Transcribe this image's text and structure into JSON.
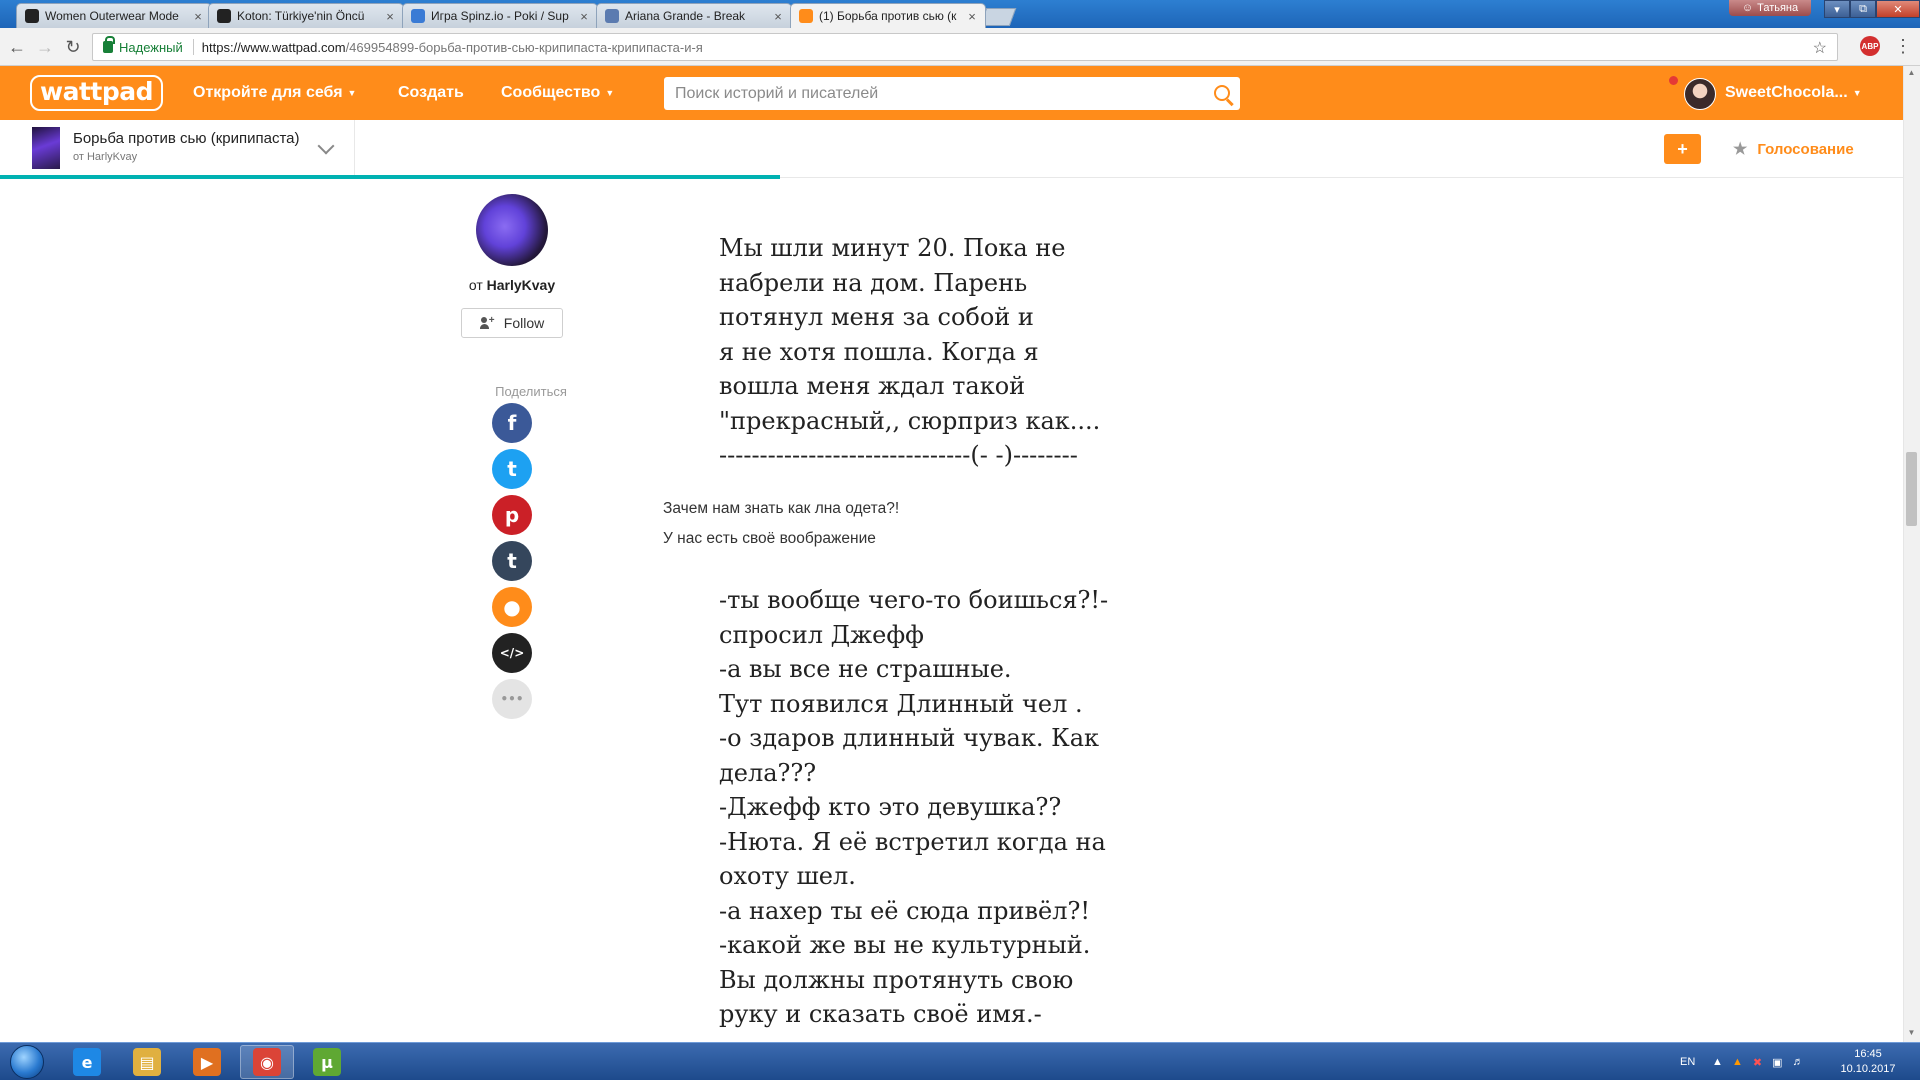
{
  "browser": {
    "tabs": [
      {
        "label": "Women Outerwear Mode",
        "icon": "koton-icon",
        "color": "#222222"
      },
      {
        "label": "Koton: Türkiye'nin Öncü",
        "icon": "koton-icon",
        "color": "#222222"
      },
      {
        "label": "Игра Spinz.io - Poki / Sup",
        "icon": "poki-icon",
        "color": "#3a7bd5"
      },
      {
        "label": "Ariana Grande - Break",
        "icon": "video-icon",
        "color": "#5b7bb0"
      },
      {
        "label": "(1) Борьба против сью (к",
        "icon": "wattpad-tab-icon",
        "color": "#ff8c1a"
      }
    ],
    "profile_name": "Татьяна",
    "secure_label": "Надежный",
    "url_host": "https://www.wattpad.com",
    "url_path": "/469954899-борьба-против-сью-крипипаста-крипипаста-и-я",
    "extension_badge": "ABP"
  },
  "header": {
    "logo": "wattpad",
    "nav_discover": "Откройте для себя",
    "nav_create": "Создать",
    "nav_community": "Сообщество",
    "search_placeholder": "Поиск историй и писателей",
    "username": "SweetChocola...",
    "accent": "#ff8c1a"
  },
  "storybar": {
    "title": "Борьба против сью (крипипаста)",
    "author_line": "от HarlyKvay",
    "add_button": "+",
    "vote_label": "Голосование",
    "progress_fraction": 0.41
  },
  "author": {
    "prefix": "от",
    "name": "HarlyKvay",
    "follow_label": "Follow"
  },
  "share": {
    "label": "Поделиться",
    "items": [
      {
        "name": "facebook-icon",
        "glyph": "f",
        "color": "#3b5998"
      },
      {
        "name": "twitter-icon",
        "glyph": "t",
        "color": "#1da1f2"
      },
      {
        "name": "pinterest-icon",
        "glyph": "p",
        "color": "#cb2027"
      },
      {
        "name": "tumblr-icon",
        "glyph": "t",
        "color": "#35465c"
      },
      {
        "name": "user-icon",
        "glyph": "●",
        "color": "#ff8c1a"
      },
      {
        "name": "embed-icon",
        "glyph": "</>",
        "color": "#222222"
      },
      {
        "name": "more-icon",
        "glyph": "•••",
        "color": "#e4e4e4"
      }
    ]
  },
  "story": {
    "block1": [
      "Мы шли минут 20. Пока не",
      "набрели на дом. Парень",
      "потянул меня за собой и",
      "я не хотя пошла. Когда я",
      "вошла меня ждал такой",
      "\"прекрасный,, сюрприз как....",
      "-------------------------------(-  -)--------"
    ],
    "note1": "Зачем нам знать как лна одета?!",
    "note2": "У нас есть своё вообрaжение",
    "block2": [
      "-ты вообще чего-то боишься?!-",
      "спросил Джефф",
      "-а вы все не страшные.",
      "Тут появился Длинный чел .",
      "-о здаров длинный чувак. Как",
      "дела???",
      "-Джефф кто это девушка??",
      "-Нюта. Я её встретил когда на",
      "охоту шел.",
      "-а нахер ты её сюда привёл?!",
      "-какой же вы не культурный.",
      "Вы должны протянуть свою",
      "руку и сказать своё имя.-"
    ]
  },
  "taskbar": {
    "apps": [
      {
        "name": "ie-icon",
        "glyph": "e",
        "color": "#1e88e5"
      },
      {
        "name": "explorer-icon",
        "glyph": "▤",
        "color": "#e0b040"
      },
      {
        "name": "media-player-icon",
        "glyph": "▶",
        "color": "#e07020"
      },
      {
        "name": "chrome-icon",
        "glyph": "◉",
        "color": "#db4437"
      },
      {
        "name": "utorrent-icon",
        "glyph": "µ",
        "color": "#5fa833"
      }
    ],
    "language": "EN",
    "time": "16:45",
    "date": "10.10.2017"
  }
}
